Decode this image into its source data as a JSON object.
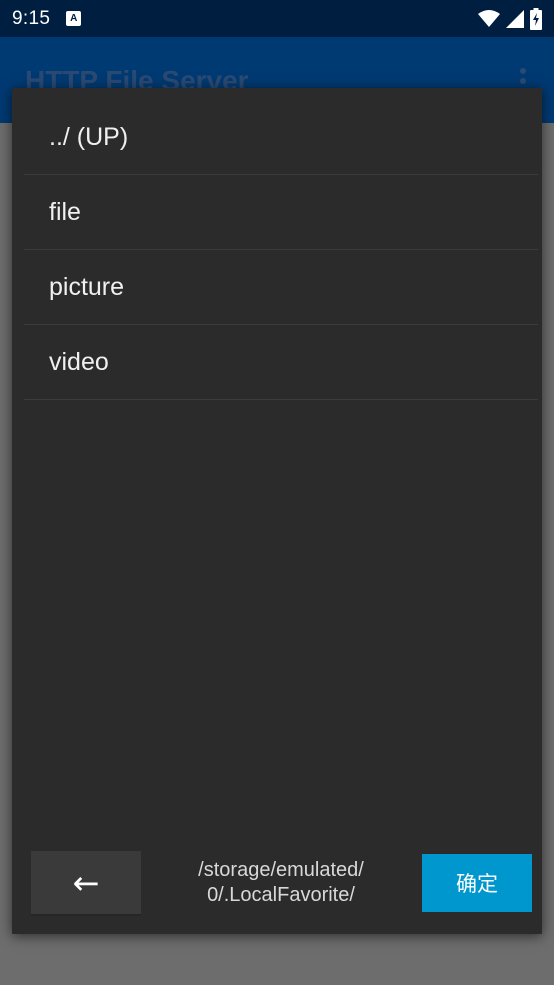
{
  "status_bar": {
    "time": "9:15",
    "notification_icon": "a-notification-icon",
    "wifi_icon": "wifi-icon",
    "signal_icon": "signal-icon",
    "battery_icon": "battery-charging-icon"
  },
  "app_bar": {
    "title": "HTTP File Server",
    "menu_icon": "overflow-menu-icon"
  },
  "dialog": {
    "items": [
      {
        "label": "../ (UP)"
      },
      {
        "label": "file"
      },
      {
        "label": "picture"
      },
      {
        "label": "video"
      }
    ],
    "back_label": "←",
    "path": "/storage/emulated/\n0/.LocalFavorite/",
    "path_line1": "/storage/emulated/",
    "path_line2": "0/.LocalFavorite/",
    "confirm_label": "确定"
  },
  "colors": {
    "status_bar": "#001f40",
    "app_bar": "#003a73",
    "dialog_bg": "#2b2b2b",
    "accent": "#0097cf"
  }
}
